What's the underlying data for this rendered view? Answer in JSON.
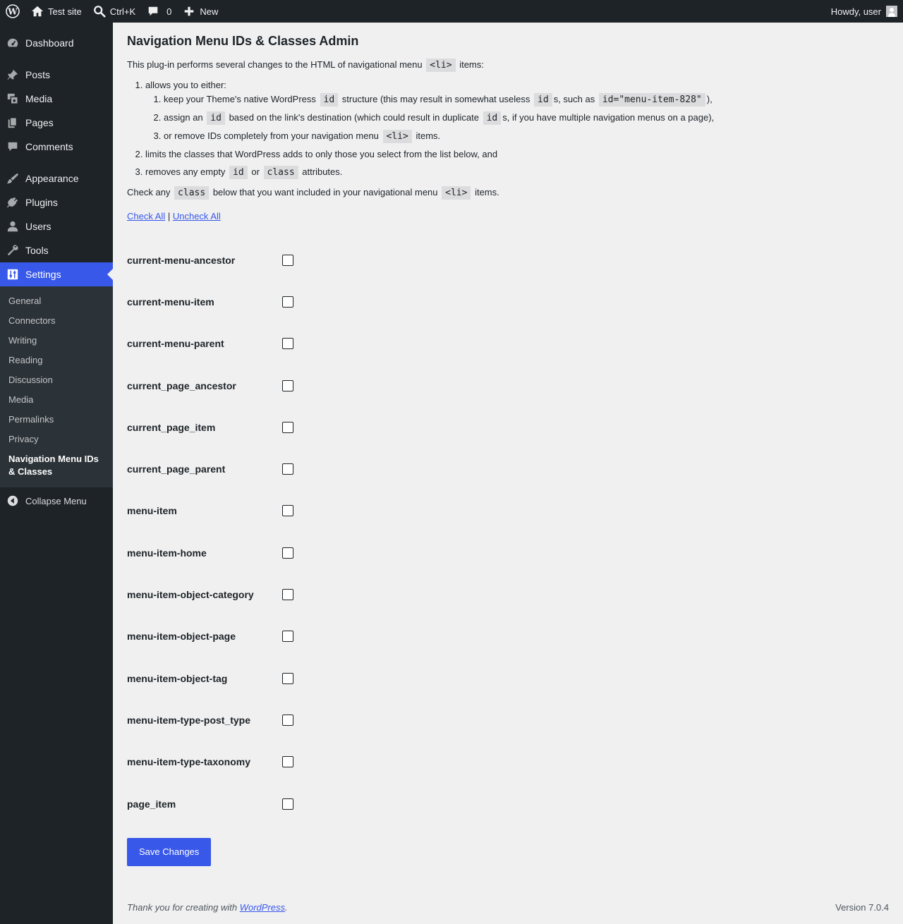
{
  "adminbar": {
    "site_name": "Test site",
    "search_shortcut": "Ctrl+K",
    "comments_count": "0",
    "new_label": "New",
    "howdy": "Howdy, user"
  },
  "sidebar": {
    "items": [
      {
        "label": "Dashboard",
        "icon": "dashboard-icon"
      },
      {
        "label": "Posts",
        "icon": "pin-icon"
      },
      {
        "label": "Media",
        "icon": "media-icon"
      },
      {
        "label": "Pages",
        "icon": "pages-icon"
      },
      {
        "label": "Comments",
        "icon": "comment-icon"
      },
      {
        "label": "Appearance",
        "icon": "brush-icon"
      },
      {
        "label": "Plugins",
        "icon": "plugin-icon"
      },
      {
        "label": "Users",
        "icon": "user-icon"
      },
      {
        "label": "Tools",
        "icon": "wrench-icon"
      },
      {
        "label": "Settings",
        "icon": "settings-icon"
      }
    ],
    "submenu": [
      "General",
      "Connectors",
      "Writing",
      "Reading",
      "Discussion",
      "Media",
      "Permalinks",
      "Privacy",
      "Navigation Menu IDs & Classes"
    ],
    "collapse_label": "Collapse Menu",
    "accent_color": "#3858e9"
  },
  "main": {
    "title": "Navigation Menu IDs & Classes Admin",
    "intro_before": "This plug-in performs several changes to the HTML of navigational menu",
    "intro_code": "<li>",
    "intro_after": "items:",
    "list": {
      "item1": "allows you to either:",
      "sub1_a": "keep your Theme's native WordPress",
      "sub1_code1": "id",
      "sub1_b": "structure (this may result in somewhat useless",
      "sub1_code2": "id",
      "sub1_c": "s, such as",
      "sub1_code3": "id=\"menu-item-828\"",
      "sub1_d": "),",
      "sub2_a": "assign an",
      "sub2_code1": "id",
      "sub2_b": "based on the link's destination (which could result in duplicate",
      "sub2_code2": "id",
      "sub2_c": "s, if you have multiple navigation menus on a page),",
      "sub3_a": "or remove IDs completely from your navigation menu",
      "sub3_code": "<li>",
      "sub3_b": "items.",
      "item2": "limits the classes that WordPress adds to only those you select from the list below, and",
      "item3_a": "removes any empty",
      "item3_code1": "id",
      "item3_b": "or",
      "item3_code2": "class",
      "item3_c": "attributes."
    },
    "check_a": "Check any",
    "check_code1": "class",
    "check_b": "below that you want included in your navigational menu",
    "check_code2": "<li>",
    "check_c": "items.",
    "check_all": "Check All",
    "separator": "|",
    "uncheck_all": "Uncheck All",
    "classes": [
      "current-menu-ancestor",
      "current-menu-item",
      "current-menu-parent",
      "current_page_ancestor",
      "current_page_item",
      "current_page_parent",
      "menu-item",
      "menu-item-home",
      "menu-item-object-category",
      "menu-item-object-page",
      "menu-item-object-tag",
      "menu-item-type-post_type",
      "menu-item-type-taxonomy",
      "page_item"
    ],
    "save_label": "Save Changes"
  },
  "footer": {
    "thanks_before": "Thank you for creating with",
    "wp_link": "WordPress",
    "thanks_after": ".",
    "version": "Version 7.0.4"
  }
}
